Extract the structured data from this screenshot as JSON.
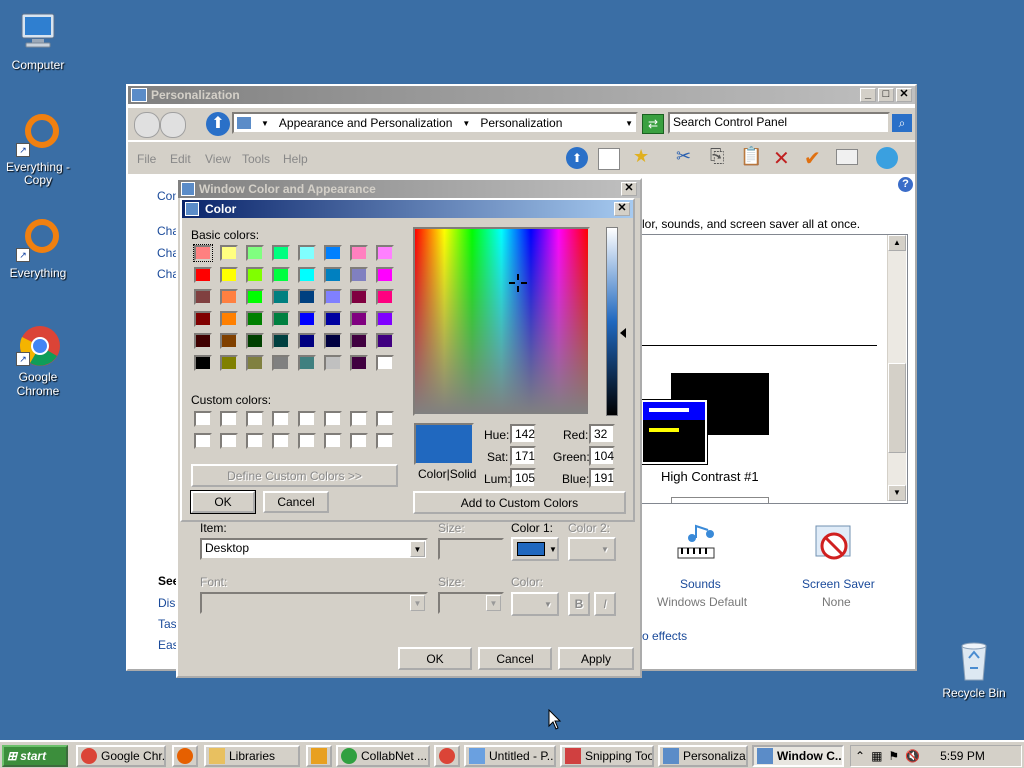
{
  "desktop": {
    "icons": [
      {
        "label": "Computer"
      },
      {
        "label": "Everything - Copy"
      },
      {
        "label": "Everything"
      },
      {
        "label": "Google Chrome"
      },
      {
        "label": "Recycle Bin"
      }
    ]
  },
  "personalization": {
    "title": "Personalization",
    "breadcrumb": [
      "Appearance and Personalization",
      "Personalization"
    ],
    "search_placeholder": "Search Control Panel",
    "menu": [
      "File",
      "Edit",
      "View",
      "Tools",
      "Help"
    ],
    "partial_links": [
      "Con",
      "Cha",
      "Cha",
      "Cha"
    ],
    "intro_text": "lor, sounds, and screen saver all at once.",
    "theme_name": "High Contrast #1",
    "sounds_label": "Sounds",
    "sounds_value": "Windows Default",
    "screensaver_label": "Screen Saver",
    "screensaver_value": "None",
    "see_also_partial": "See",
    "see_also_links": [
      "Disp",
      "Tasl",
      "Eas"
    ],
    "effects_link": "o effects"
  },
  "wca": {
    "title": "Window Color and Appearance",
    "item_label": "Item:",
    "item_value": "Desktop",
    "size_label": "Size:",
    "color1_label": "Color 1:",
    "color2_label": "Color 2:",
    "font_label": "Font:",
    "font_size_label": "Size:",
    "font_color_label": "Color:",
    "bold_label": "B",
    "italic_label": "I",
    "ok": "OK",
    "cancel": "Cancel",
    "apply": "Apply",
    "color1_hex": "#2068bf"
  },
  "color_dialog": {
    "title": "Color",
    "basic_colors_label": "Basic colors:",
    "custom_colors_label": "Custom colors:",
    "define_custom": "Define Custom Colors >>",
    "ok": "OK",
    "cancel": "Cancel",
    "add_custom": "Add to Custom Colors",
    "color_solid_label": "Color|Solid",
    "hue_label": "Hue:",
    "hue": "142",
    "sat_label": "Sat:",
    "sat": "171",
    "lum_label": "Lum:",
    "lum": "105",
    "red_label": "Red:",
    "red": "32",
    "green_label": "Green:",
    "green": "104",
    "blue_label": "Blue:",
    "blue": "191",
    "current_color": "#2068bf",
    "basic_colors": [
      "#ff8080",
      "#ffff80",
      "#80ff80",
      "#00ff80",
      "#80ffff",
      "#0080ff",
      "#ff80c0",
      "#ff80ff",
      "#ff0000",
      "#ffff00",
      "#80ff00",
      "#00ff40",
      "#00ffff",
      "#0080c0",
      "#8080c0",
      "#ff00ff",
      "#804040",
      "#ff8040",
      "#00ff00",
      "#008080",
      "#004080",
      "#8080ff",
      "#800040",
      "#ff0080",
      "#800000",
      "#ff8000",
      "#008000",
      "#008040",
      "#0000ff",
      "#0000a0",
      "#800080",
      "#8000ff",
      "#400000",
      "#804000",
      "#004000",
      "#004040",
      "#000080",
      "#000040",
      "#400040",
      "#400080",
      "#000000",
      "#808000",
      "#808040",
      "#808080",
      "#408080",
      "#c0c0c0",
      "#400040",
      "#ffffff"
    ]
  },
  "taskbar": {
    "start": "start",
    "items": [
      {
        "label": "Google Chr..."
      },
      {
        "label": "Libraries"
      },
      {
        "label": "CollabNet ..."
      },
      {
        "label": "Untitled - P..."
      },
      {
        "label": "Snipping Tool"
      },
      {
        "label": "Personaliza..."
      },
      {
        "label": "Window C..."
      }
    ],
    "clock": "5:59 PM"
  }
}
